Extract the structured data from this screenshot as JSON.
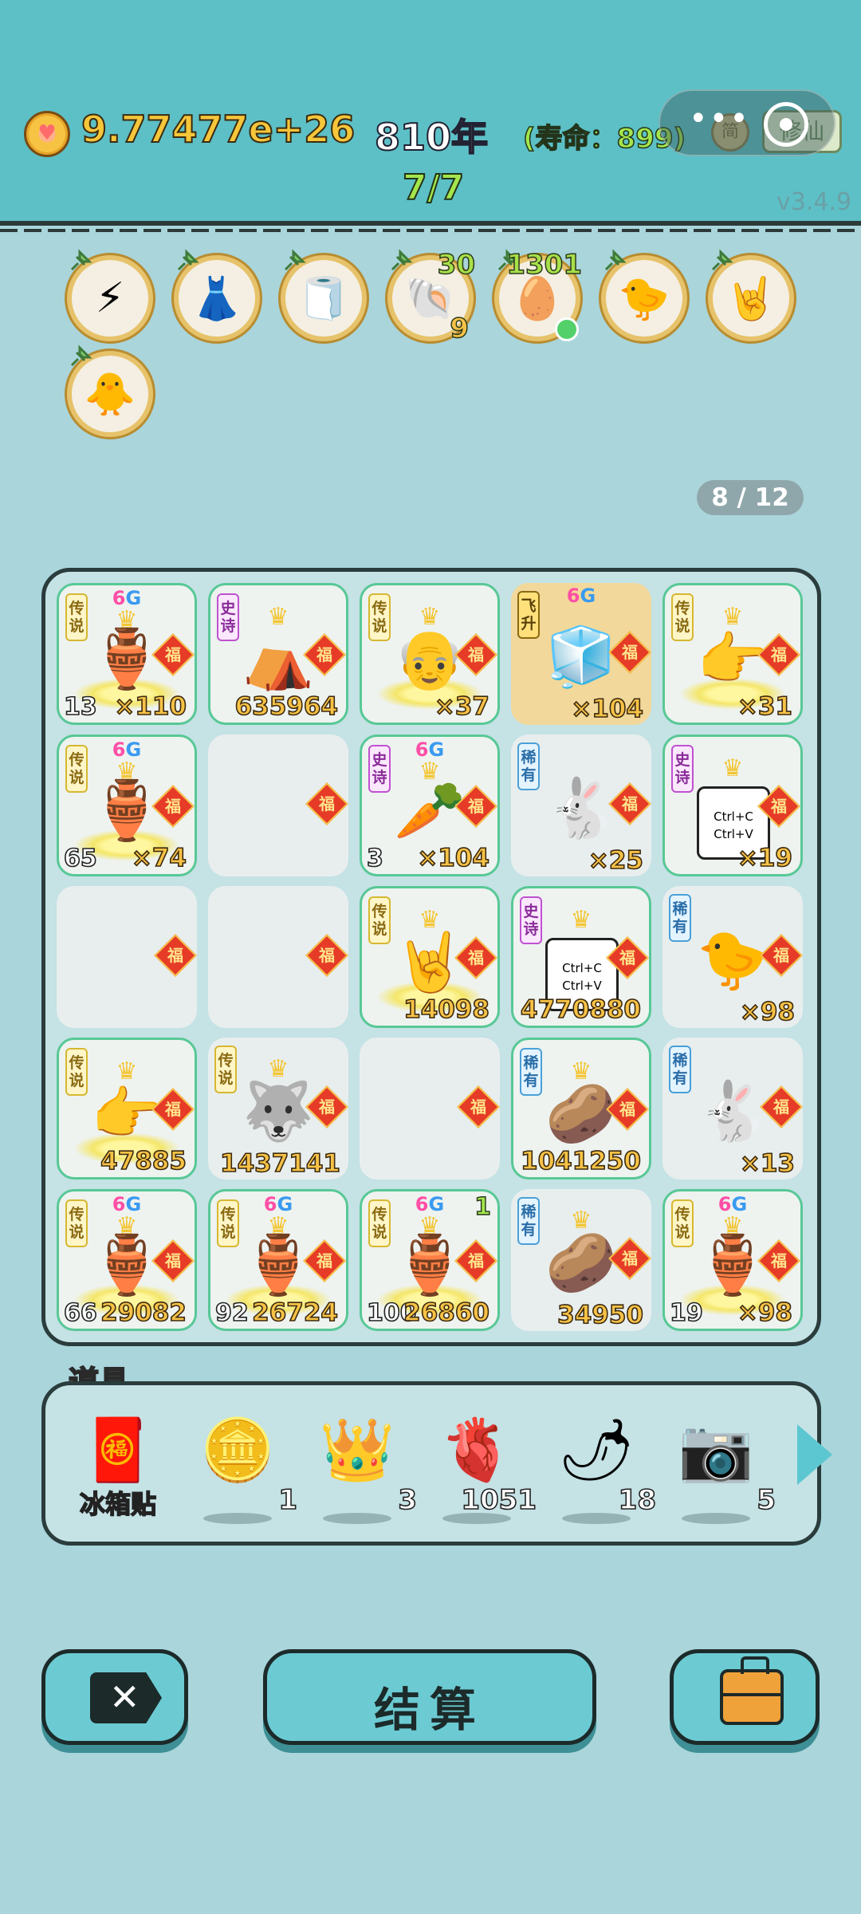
{
  "header": {
    "coins": "9.77477e+26",
    "year": "810年",
    "lifespan": "(寿命：899)",
    "turn": "7/7",
    "version": "v3.4.9",
    "badge_jian": "简",
    "badge_xian": "修仙",
    "menu_more": "•••"
  },
  "buffs": [
    {
      "icon": "lightning-icon",
      "glyph": "⚡"
    },
    {
      "icon": "skirt-icon",
      "glyph": "👗"
    },
    {
      "icon": "tissue-box-icon",
      "glyph": "🧻"
    },
    {
      "icon": "shell-icon",
      "glyph": "🐚",
      "top": "30",
      "bottom": "9"
    },
    {
      "icon": "egg-tray-icon",
      "glyph": "🥚",
      "top": "1301"
    },
    {
      "icon": "chick-syringe-icon",
      "glyph": "🐤"
    },
    {
      "icon": "rock-hand-icon",
      "glyph": "🤘"
    },
    {
      "icon": "chick-egg-icon",
      "glyph": "🐥"
    }
  ],
  "page_indicator": "8 / 12",
  "fu": "福",
  "g6": {
    "six": "6",
    "g": "G"
  },
  "crown_glyph": "♛",
  "grid": [
    {
      "tag": "传说",
      "tagc": "legend",
      "icon": "green-vase-icon",
      "glyph": "🏺",
      "g6": true,
      "crown": true,
      "swirl": true,
      "lvl": "13",
      "count": "×110"
    },
    {
      "tag": "史诗",
      "tagc": "epic",
      "icon": "tent-icon",
      "glyph": "⛺",
      "crown": true,
      "swirl": false,
      "count": "635964"
    },
    {
      "tag": "传说",
      "tagc": "legend",
      "icon": "old-man-face-icon",
      "glyph": "👴",
      "crown": true,
      "swirl": true,
      "count": "×37"
    },
    {
      "tag": "飞升",
      "tagc": "fly",
      "icon": "fridge-icon",
      "glyph": "🧊",
      "g6": true,
      "gold": true,
      "count": "×104"
    },
    {
      "tag": "传说",
      "tagc": "legend",
      "icon": "pointing-hand-icon",
      "glyph": "👉",
      "crown": true,
      "swirl": true,
      "count": "×31"
    },
    {
      "tag": "传说",
      "tagc": "legend",
      "icon": "green-vase-icon",
      "glyph": "🏺",
      "g6": true,
      "crown": true,
      "swirl": true,
      "lvl": "65",
      "count": "×74"
    },
    {
      "empty": true
    },
    {
      "tag": "史诗",
      "tagc": "epic",
      "icon": "carrot-icon",
      "glyph": "🥕",
      "g6": true,
      "crown": true,
      "lvl": "3",
      "count": "×104"
    },
    {
      "tag": "稀有",
      "tagc": "rare",
      "icon": "rabbit-icon",
      "glyph": "🐇",
      "count": "×25",
      "plain": true
    },
    {
      "tag": "史诗",
      "tagc": "epic",
      "icon": "ctrl-cv-card-icon",
      "glyph": "📋",
      "crown": true,
      "count": "×19",
      "card": "Ctrl+C Ctrl+V"
    },
    {
      "empty": true
    },
    {
      "empty": true
    },
    {
      "tag": "传说",
      "tagc": "legend",
      "icon": "rock-hand-icon",
      "glyph": "🤘",
      "crown": true,
      "swirl": true,
      "count": "14098"
    },
    {
      "tag": "史诗",
      "tagc": "epic",
      "icon": "ctrl-cv-card-icon",
      "glyph": "📋",
      "crown": true,
      "count": "4770880",
      "card": "Ctrl+C Ctrl+V"
    },
    {
      "tag": "稀有",
      "tagc": "rare",
      "icon": "chick-icon",
      "glyph": "🐤",
      "count": "×98",
      "plain": true
    },
    {
      "tag": "传说",
      "tagc": "legend",
      "icon": "pointing-hand-icon",
      "glyph": "👉",
      "crown": true,
      "swirl": true,
      "count": "47885"
    },
    {
      "tag": "传说",
      "tagc": "legend",
      "icon": "husky-icon",
      "glyph": "🐺",
      "crown": true,
      "count": "1437141",
      "plain": true
    },
    {
      "empty": true
    },
    {
      "tag": "稀有",
      "tagc": "rare",
      "icon": "potato-icon",
      "glyph": "🥔",
      "crown": true,
      "count": "1041250"
    },
    {
      "tag": "稀有",
      "tagc": "rare",
      "icon": "rabbit-icon",
      "glyph": "🐇",
      "count": "×13",
      "plain": true
    },
    {
      "tag": "传说",
      "tagc": "legend",
      "icon": "green-vase-icon",
      "glyph": "🏺",
      "g6": true,
      "crown": true,
      "swirl": true,
      "lvl": "66",
      "count": "29082"
    },
    {
      "tag": "传说",
      "tagc": "legend",
      "icon": "green-vase-icon",
      "glyph": "🏺",
      "g6": true,
      "crown": true,
      "swirl": true,
      "lvl": "92",
      "count": "26724"
    },
    {
      "tag": "传说",
      "tagc": "legend",
      "icon": "green-vase-icon",
      "glyph": "🏺",
      "g6": true,
      "crown": true,
      "swirl": true,
      "lvl": "100",
      "count": "26860",
      "corner": "1"
    },
    {
      "tag": "稀有",
      "tagc": "rare",
      "icon": "potato-icon",
      "glyph": "🥔",
      "crown": true,
      "count": "34950",
      "plain": true
    },
    {
      "tag": "传说",
      "tagc": "legend",
      "icon": "green-vase-icon",
      "glyph": "🏺",
      "g6": true,
      "crown": true,
      "swirl": true,
      "lvl": "19",
      "count": "×98"
    }
  ],
  "props": {
    "title": "道具",
    "items": [
      {
        "icon": "fridge-magnet-fu-icon",
        "glyph": "🧧",
        "label": "冰箱贴"
      },
      {
        "icon": "dollar-coin-icon",
        "glyph": "🪙",
        "count": "1"
      },
      {
        "icon": "crown-icon",
        "glyph": "👑",
        "count": "3"
      },
      {
        "icon": "liver-icon",
        "glyph": "🫀",
        "count": "1051"
      },
      {
        "icon": "chili-pepper-icon",
        "glyph": "🌶",
        "count": "18"
      },
      {
        "icon": "camera-icon",
        "glyph": "📷",
        "count": "5"
      }
    ]
  },
  "buttons": {
    "delete_glyph": "✕",
    "settle": "结算"
  }
}
